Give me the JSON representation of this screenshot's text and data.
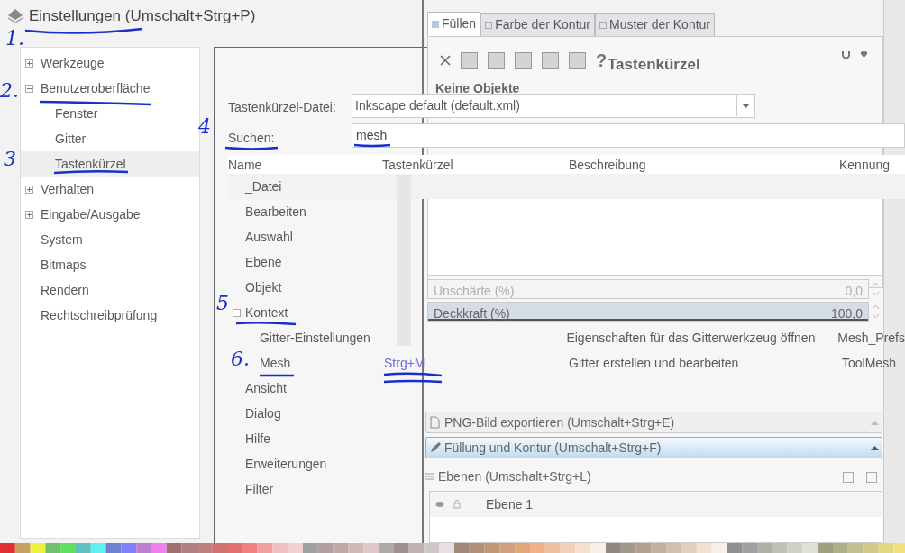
{
  "window": {
    "title": "Einstellungen (Umschalt+Strg+P)"
  },
  "sidebar": {
    "items": [
      {
        "label": "Werkzeuge",
        "kind": "group",
        "expanded": false,
        "selected": false
      },
      {
        "label": "Benutzeroberfläche",
        "kind": "group",
        "expanded": true,
        "selected": false,
        "children": [
          {
            "label": "Fenster",
            "selected": false
          },
          {
            "label": "Gitter",
            "selected": false
          },
          {
            "label": "Tastenkürzel",
            "selected": true
          }
        ]
      },
      {
        "label": "Verhalten",
        "kind": "group",
        "expanded": false,
        "selected": false
      },
      {
        "label": "Eingabe/Ausgabe",
        "kind": "group",
        "expanded": false,
        "selected": false
      },
      {
        "label": "System",
        "kind": "leaf",
        "selected": false
      },
      {
        "label": "Bitmaps",
        "kind": "leaf",
        "selected": false
      },
      {
        "label": "Rendern",
        "kind": "leaf",
        "selected": false
      },
      {
        "label": "Rechtschreibprüfung",
        "kind": "leaf",
        "selected": false
      }
    ]
  },
  "shortcuts": {
    "title": "Tastenkürzel",
    "file_label": "Tastenkürzel-Datei:",
    "file_value": "Inkscape default (default.xml)",
    "search_label": "Suchen:",
    "search_value": "mesh",
    "columns": [
      "Name",
      "Tastenkürzel",
      "Beschreibung",
      "Kennung"
    ],
    "rows": [
      {
        "name": "_Datei"
      },
      {
        "name": "Bearbeiten"
      },
      {
        "name": "Auswahl"
      },
      {
        "name": "Ebene"
      },
      {
        "name": "Objekt"
      },
      {
        "name": "Kontext",
        "expanded": true,
        "children": [
          {
            "name": "Gitter-Einstellungen",
            "description": "Eigenschaften für das Gitterwerkzeug öffnen",
            "id": "Mesh_Prefs"
          },
          {
            "name": "Mesh",
            "shortcut": "Strg+M",
            "description": "Gitter erstellen und bearbeiten",
            "id": "ToolMesh"
          }
        ]
      },
      {
        "name": "Ansicht"
      },
      {
        "name": "Dialog"
      },
      {
        "name": "Hilfe"
      },
      {
        "name": "Erweiterungen"
      },
      {
        "name": "Filter"
      }
    ]
  },
  "fill_stroke": {
    "tabs": [
      {
        "label": "Füllen",
        "selected": true
      },
      {
        "label": "Farbe der Kontur",
        "selected": false
      },
      {
        "label": "Muster der Kontur",
        "selected": false
      }
    ],
    "toolbar_help": "?",
    "heading": "Keine Objekte",
    "fields": [
      {
        "label": "Unschärfe (%)",
        "value": "0,0",
        "disabled": true
      },
      {
        "label": "Deckkraft (%)",
        "value": "100,0",
        "disabled": false,
        "level": 1
      }
    ]
  },
  "docks": [
    {
      "label": "PNG-Bild exportieren (Umschalt+Strg+E)",
      "selected": false
    },
    {
      "label": "Füllung und Kontur (Umschalt+Strg+F)",
      "selected": true
    }
  ],
  "layers": {
    "title": "Ebenen (Umschalt+Strg+L)",
    "items": [
      {
        "name": "Ebene 1"
      }
    ]
  },
  "annotations": [
    "1.",
    "2.",
    "3",
    "4",
    "5",
    "6."
  ]
}
